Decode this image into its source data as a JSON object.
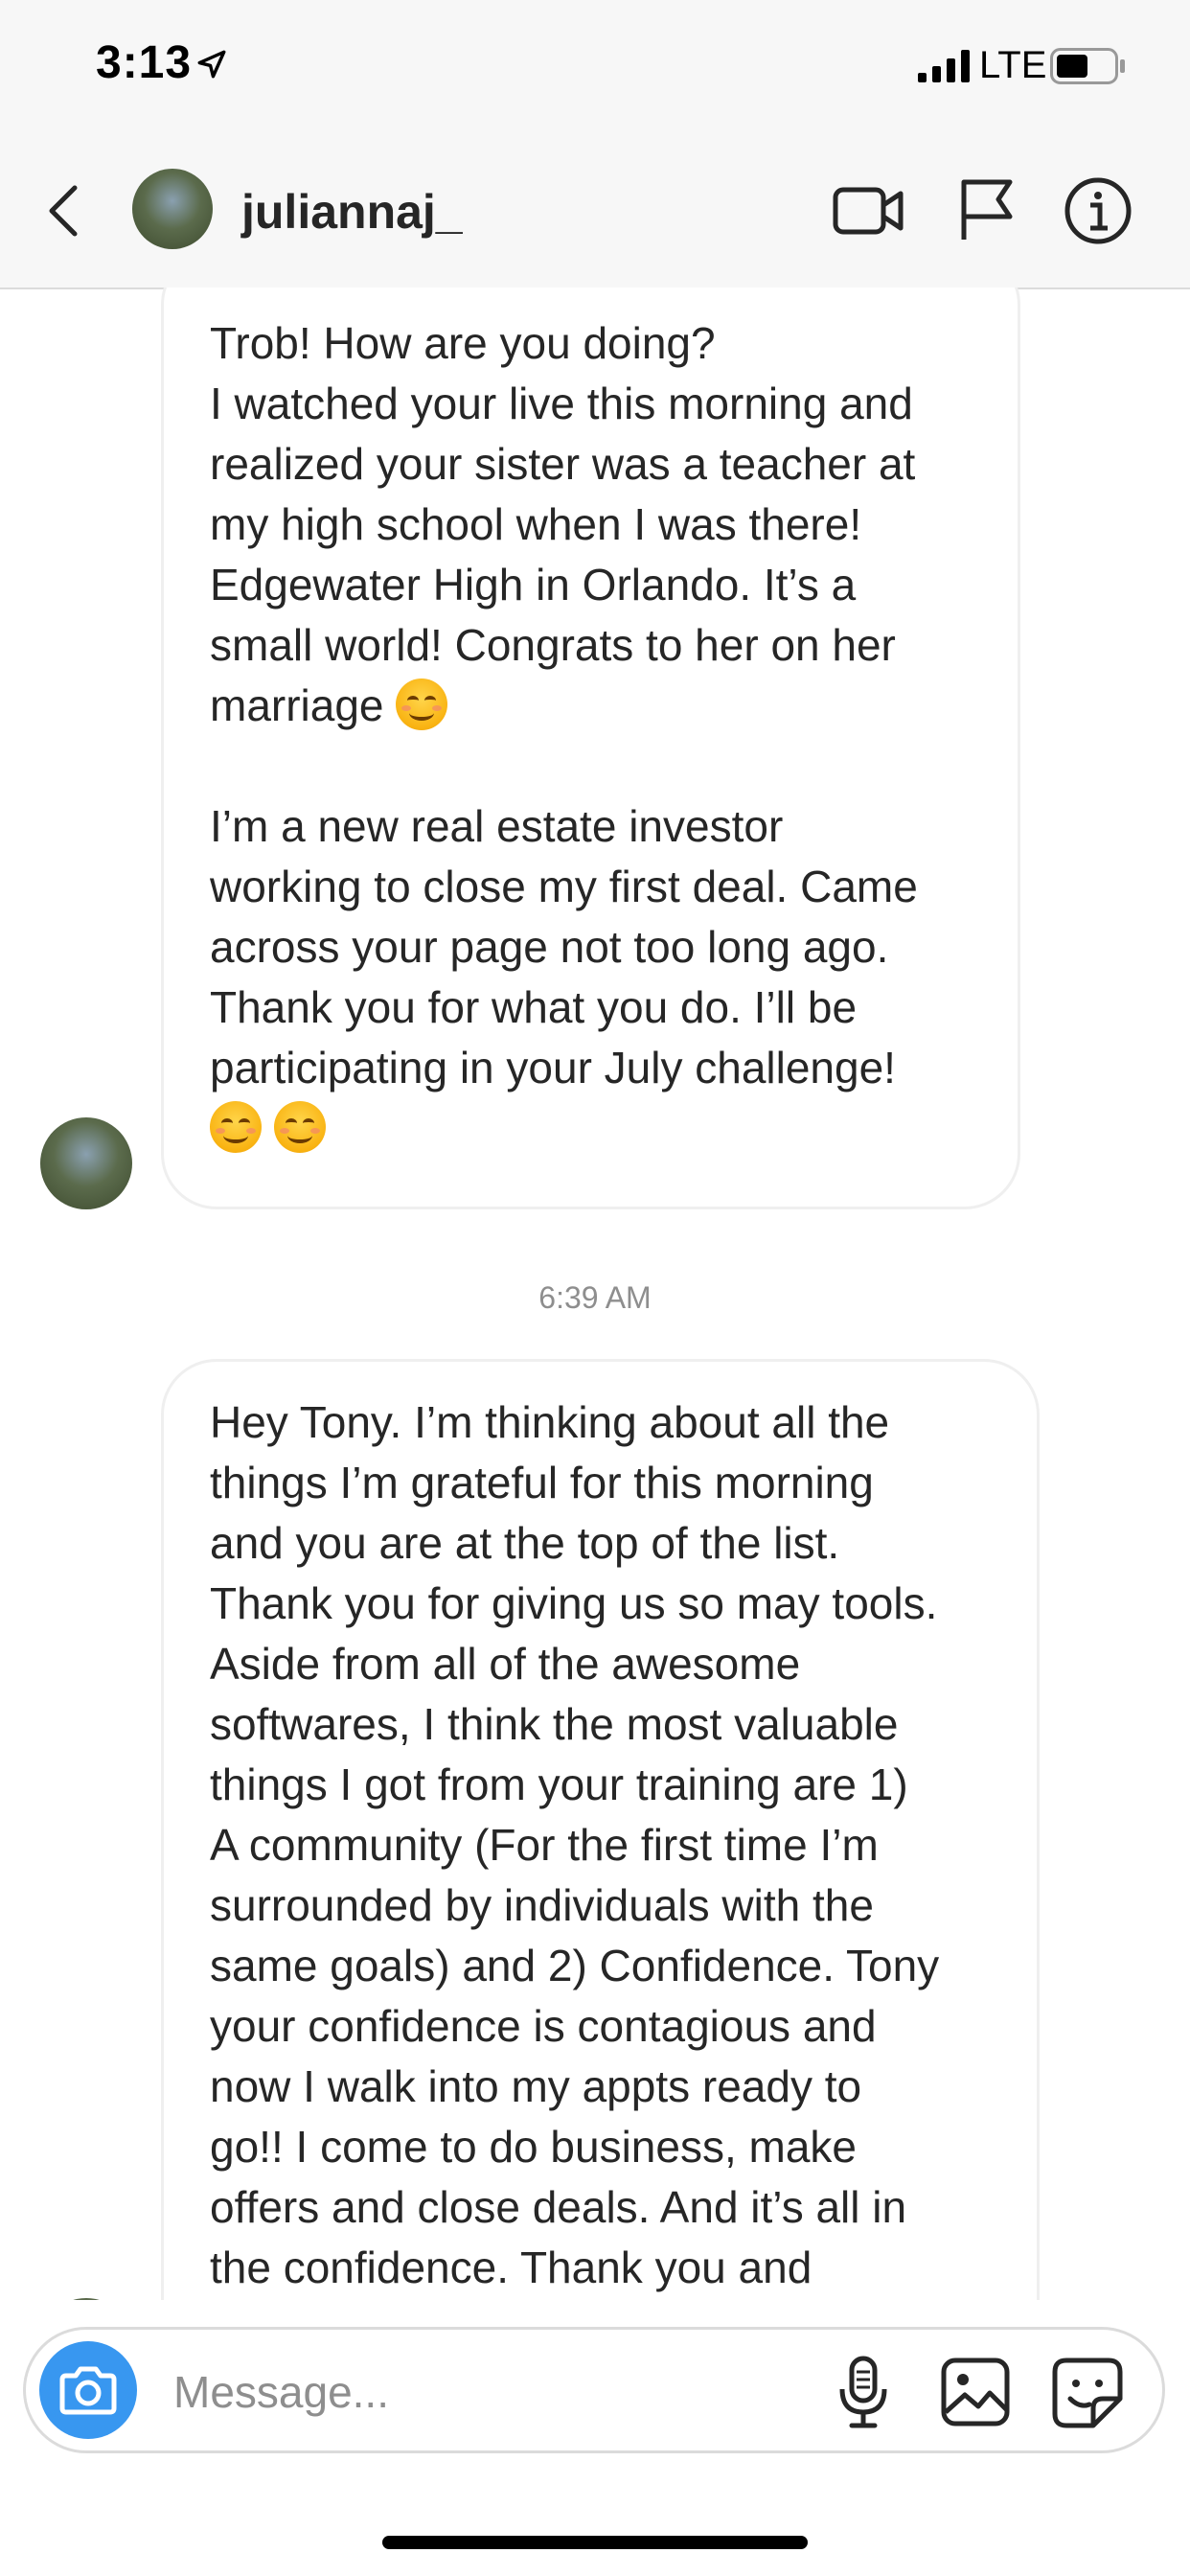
{
  "status_bar": {
    "time": "3:13",
    "network": "LTE",
    "location_icon": "location-arrow-icon"
  },
  "header": {
    "username": "juliannaj_",
    "icons": [
      "back-icon",
      "video-call-icon",
      "flag-icon",
      "info-icon"
    ]
  },
  "messages": [
    {
      "sender": "juliannaj_",
      "text_parts": [
        "Trob! How are you doing?\nI watched your live this morning and\nrealized your sister was a teacher at\nmy high school when I was there!\nEdgewater High in Orlando. It’s a\nsmall world! Congrats to her on her\nmarriage ",
        "\n\nI’m a new real estate investor\nworking to close my first deal. Came\nacross your page not too long ago.\nThank you for what you do. I’ll be\nparticipating in your July challenge!\n"
      ]
    },
    {
      "sender": "juliannaj_",
      "text": "Hey Tony. I’m thinking about all the\nthings I’m grateful for this morning\nand you are at the top of the list.\nThank you for giving us so may tools.\nAside from all of the awesome\nsoftwares, I think the most valuable\nthings I got from your training are 1)\nA community (For the first time I’m\nsurrounded by individuals with the\nsame goals) and 2) Confidence. Tony\nyour confidence is contagious and\nnow I walk into my appts ready to\ngo!! I come to do business, make\noffers and close deals. And it’s all in\nthe confidence. Thank you and"
    }
  ],
  "timestamp": "6:39 AM",
  "composer": {
    "placeholder": "Message..."
  },
  "colors": {
    "accent": "#3897f0",
    "bubble_border": "#efefef",
    "timestamp": "#8e8e8e"
  }
}
